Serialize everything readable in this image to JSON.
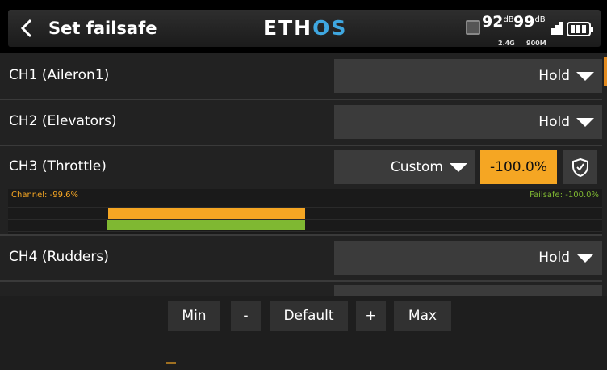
{
  "header": {
    "title": "Set failsafe",
    "logo_part1": "ETH",
    "logo_part2": "OS",
    "rssi1_value": "92",
    "rssi1_unit": "dB",
    "rssi1_band": "2.4G",
    "rssi2_value": "99",
    "rssi2_unit": "dB",
    "rssi2_band": "900M",
    "icons": [
      "back-arrow-icon",
      "rf-module-icon",
      "volume-icon",
      "battery-icon"
    ]
  },
  "channels": [
    {
      "label": "CH1 (Aileron1)",
      "mode": "Hold"
    },
    {
      "label": "CH2 (Elevators)",
      "mode": "Hold"
    },
    {
      "label": "CH3 (Throttle)",
      "mode": "Custom",
      "value": "-100.0%"
    },
    {
      "label": "CH4 (Rudders)",
      "mode": "Hold"
    }
  ],
  "bar_panel": {
    "channel_label": "Channel: -99.6%",
    "failsafe_label": "Failsafe: -100.0%",
    "channel_value": -99.6,
    "failsafe_value": -100.0
  },
  "footer": {
    "min": "Min",
    "minus": "-",
    "default": "Default",
    "plus": "+",
    "max": "Max"
  },
  "colors": {
    "accent_orange": "#f5a623",
    "failsafe_green": "#7fb832",
    "logo_blue": "#3fa7e0",
    "scroll_orange": "#e28a1e"
  }
}
